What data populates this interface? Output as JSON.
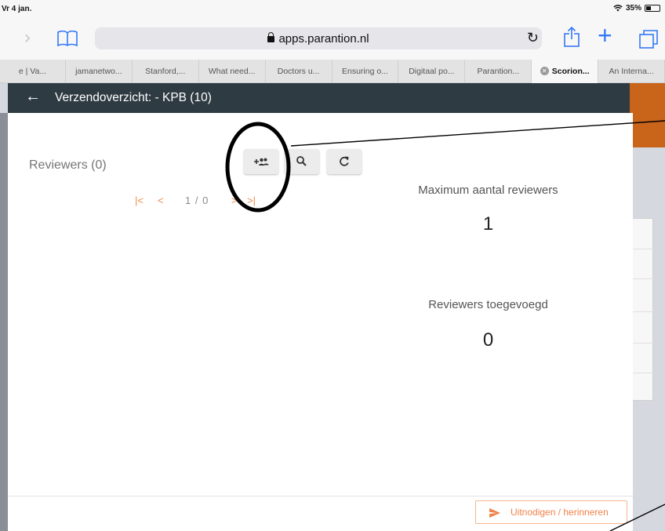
{
  "status_bar": {
    "time": "Vr 4 jan.",
    "battery": "35%"
  },
  "browser": {
    "url": "apps.parantion.nl",
    "icons": [
      "chevron-right-icon",
      "bookmarks-icon",
      "lock-icon",
      "reload-icon",
      "share-icon",
      "plus-icon",
      "tabs-icon"
    ],
    "tabs": [
      {
        "label": "e | Va..."
      },
      {
        "label": "jamanetwo..."
      },
      {
        "label": "Stanford,..."
      },
      {
        "label": "What need..."
      },
      {
        "label": "Doctors u..."
      },
      {
        "label": "Ensuring o..."
      },
      {
        "label": "Digitaal po..."
      },
      {
        "label": "Parantion..."
      },
      {
        "label": "Scorion...",
        "active": true
      },
      {
        "label": "An Interna..."
      }
    ]
  },
  "modal": {
    "title": "Verzendoverzicht: - KPB (10)",
    "reviewers_heading": "Reviewers (0)",
    "toolbar_icons": [
      "add-reviewer-icon",
      "search-icon",
      "refresh-icon"
    ],
    "pager": {
      "first": "|<",
      "prev": "<",
      "count": "1 / 0",
      "next": ">",
      "last": ">|"
    },
    "max_reviewers_label": "Maximum aantal reviewers",
    "max_reviewers_value": "1",
    "reviewers_added_label": "Reviewers toegevoegd",
    "reviewers_added_value": "0",
    "invite_button": "Uitnodigen / herinneren"
  },
  "colors": {
    "header_bg": "#2f3b43",
    "accent_orange": "#f0824a",
    "safari_blue": "#3478f6",
    "page_orange": "#c9651b"
  }
}
